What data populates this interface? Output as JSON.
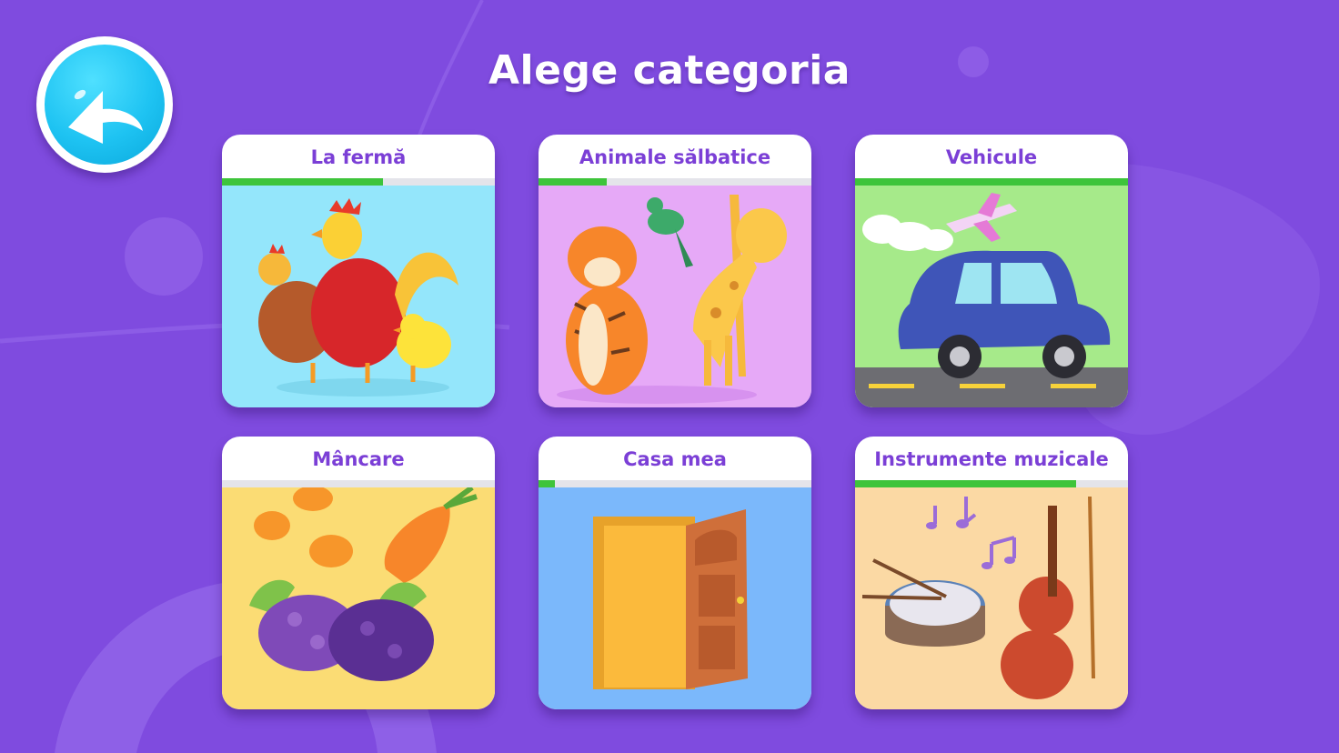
{
  "screen": {
    "title": "Alege categoria",
    "accent_color": "#7f4bdf",
    "progress_color": "#3ec43b",
    "label_color": "#7b3fd6"
  },
  "back_button": {
    "icon": "back-arrow-icon"
  },
  "categories": [
    {
      "label": "La fermă",
      "progress": 0.59,
      "art_bg": "#94e6fb",
      "illustration": "farm-birds-icon"
    },
    {
      "label": "Animale sălbatice",
      "progress": 0.25,
      "art_bg": "#e6a9f7",
      "illustration": "wild-animals-icon"
    },
    {
      "label": "Vehicule",
      "progress": 1.0,
      "art_bg": "#a6ea8a",
      "illustration": "vehicles-icon"
    },
    {
      "label": "Mâncare",
      "progress": 0.0,
      "art_bg": "#fbdc74",
      "illustration": "food-icon"
    },
    {
      "label": "Casa mea",
      "progress": 0.06,
      "art_bg": "#7bb8fb",
      "illustration": "door-icon"
    },
    {
      "label": "Instrumente muzicale",
      "progress": 0.81,
      "art_bg": "#fbd9a4",
      "illustration": "music-instruments-icon"
    }
  ]
}
